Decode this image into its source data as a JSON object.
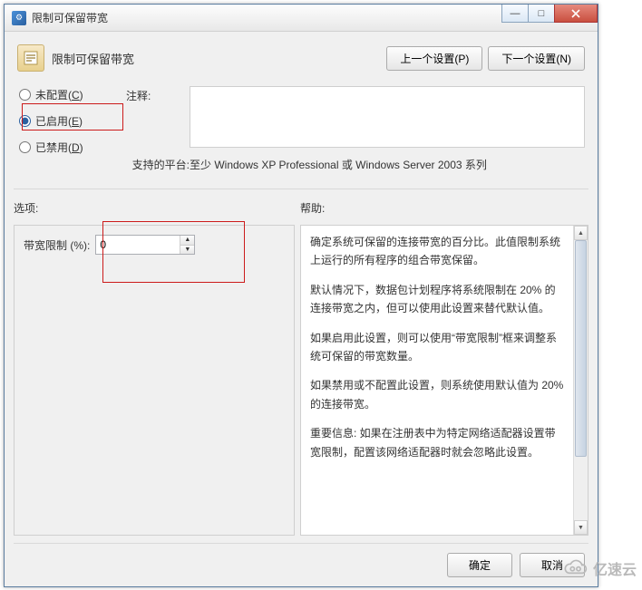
{
  "window": {
    "title": "限制可保留带宽",
    "minimize": "—",
    "maximize": "□",
    "close": "✕"
  },
  "header": {
    "title": "限制可保留带宽",
    "prev": "上一个设置(P)",
    "next": "下一个设置(N)"
  },
  "radios": {
    "not_configured": {
      "label": "未配置(",
      "accel": "C",
      "label_end": ")",
      "checked": false
    },
    "enabled": {
      "label": "已启用(",
      "accel": "E",
      "label_end": ")",
      "checked": true
    },
    "disabled": {
      "label": "已禁用(",
      "accel": "D",
      "label_end": ")",
      "checked": false
    }
  },
  "labels": {
    "comment": "注释:",
    "platform": "支持的平台:",
    "options": "选项:",
    "help": "帮助:"
  },
  "comment_value": "",
  "platform_value": "至少 Windows XP Professional 或 Windows Server 2003 系列",
  "option_field": {
    "label": "带宽限制 (%):",
    "value": "0"
  },
  "help_text": {
    "p1": "确定系统可保留的连接带宽的百分比。此值限制系统上运行的所有程序的组合带宽保留。",
    "p2": "默认情况下，数据包计划程序将系统限制在 20% 的连接带宽之内，但可以使用此设置来替代默认值。",
    "p3": "如果启用此设置，则可以使用“带宽限制”框来调整系统可保留的带宽数量。",
    "p4": "如果禁用或不配置此设置，则系统使用默认值为 20% 的连接带宽。",
    "p5": "重要信息: 如果在注册表中为特定网络适配器设置带宽限制，配置该网络适配器时就会忽略此设置。"
  },
  "footer": {
    "ok": "确定",
    "cancel": "取消"
  },
  "watermark": "亿速云"
}
